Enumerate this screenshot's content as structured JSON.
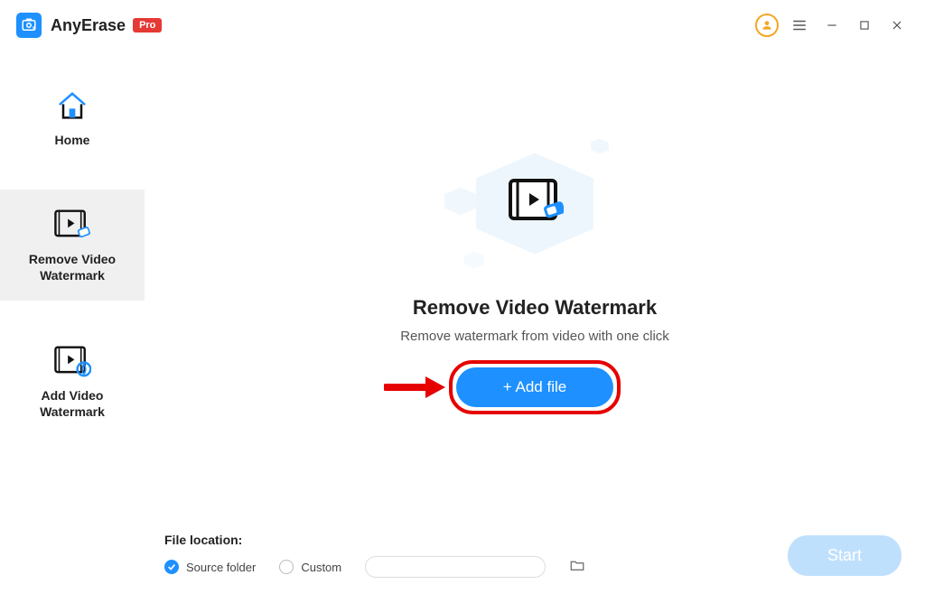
{
  "title": {
    "app_name": "AnyErase",
    "pro_label": "Pro"
  },
  "sidebar": {
    "items": [
      {
        "label": "Home"
      },
      {
        "label": "Remove Video\nWatermark"
      },
      {
        "label": "Add Video\nWatermark"
      }
    ]
  },
  "main": {
    "heading": "Remove Video Watermark",
    "subheading": "Remove watermark from video with one click",
    "add_file_label": "+ Add file"
  },
  "bottom": {
    "location_label": "File location:",
    "source_folder_label": "Source folder",
    "custom_label": "Custom",
    "start_label": "Start"
  }
}
